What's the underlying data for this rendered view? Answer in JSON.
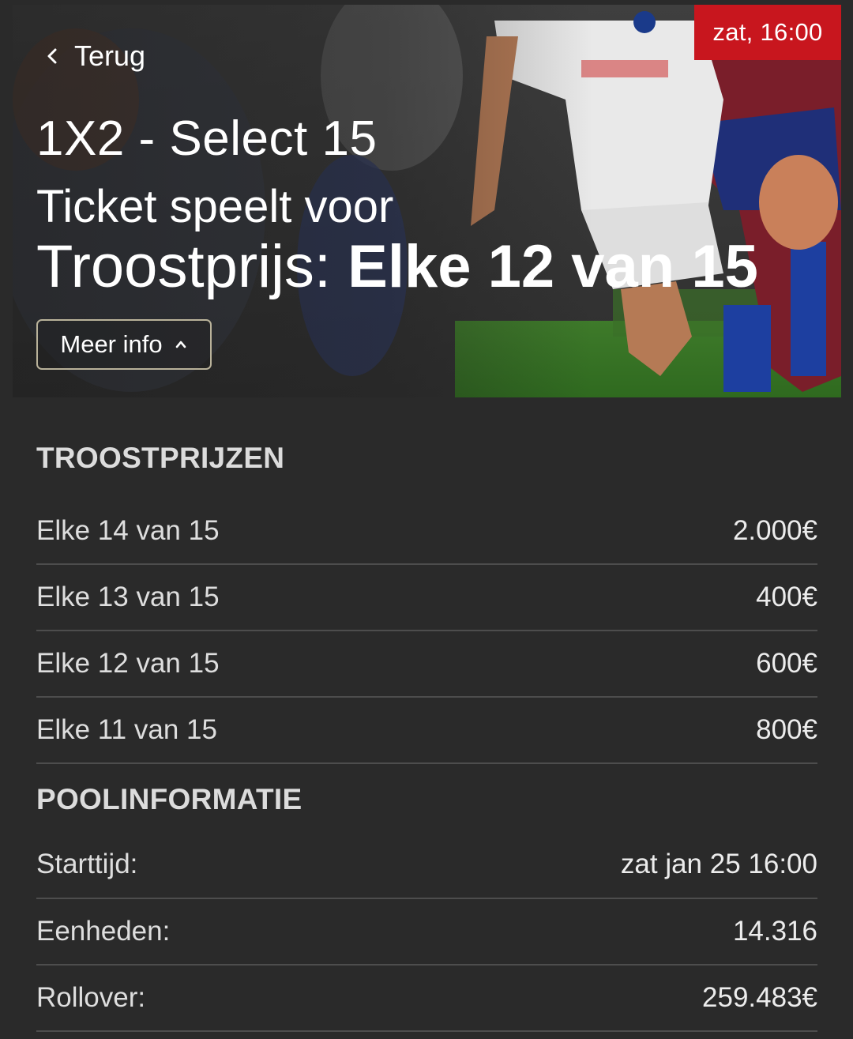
{
  "header": {
    "back_label": "Terug",
    "time_badge": "zat, 16:00",
    "title": "1X2 - Select 15",
    "subtitle": "Ticket speelt voor",
    "prize_prefix": "Troostprijs: ",
    "prize_value": "Elke 12 van 15",
    "more_info_label": "Meer info"
  },
  "consolation": {
    "title": "TROOSTPRIJZEN",
    "rows": [
      {
        "label": "Elke 14 van 15",
        "value": "2.000€"
      },
      {
        "label": "Elke 13 van 15",
        "value": "400€"
      },
      {
        "label": "Elke 12 van 15",
        "value": "600€"
      },
      {
        "label": "Elke 11 van 15",
        "value": "800€"
      }
    ]
  },
  "pool": {
    "title": "POOLINFORMATIE",
    "rows": [
      {
        "label": "Starttijd:",
        "value": "zat jan 25 16:00"
      },
      {
        "label": "Eenheden:",
        "value": "14.316"
      },
      {
        "label": "Rollover:",
        "value": "259.483€"
      }
    ]
  },
  "colors": {
    "background": "#2a2a2a",
    "accent_red": "#c8161e",
    "divider": "#4d4d4d"
  },
  "icons": {
    "back": "chevron-left-icon",
    "more_info": "chevron-up-icon"
  }
}
